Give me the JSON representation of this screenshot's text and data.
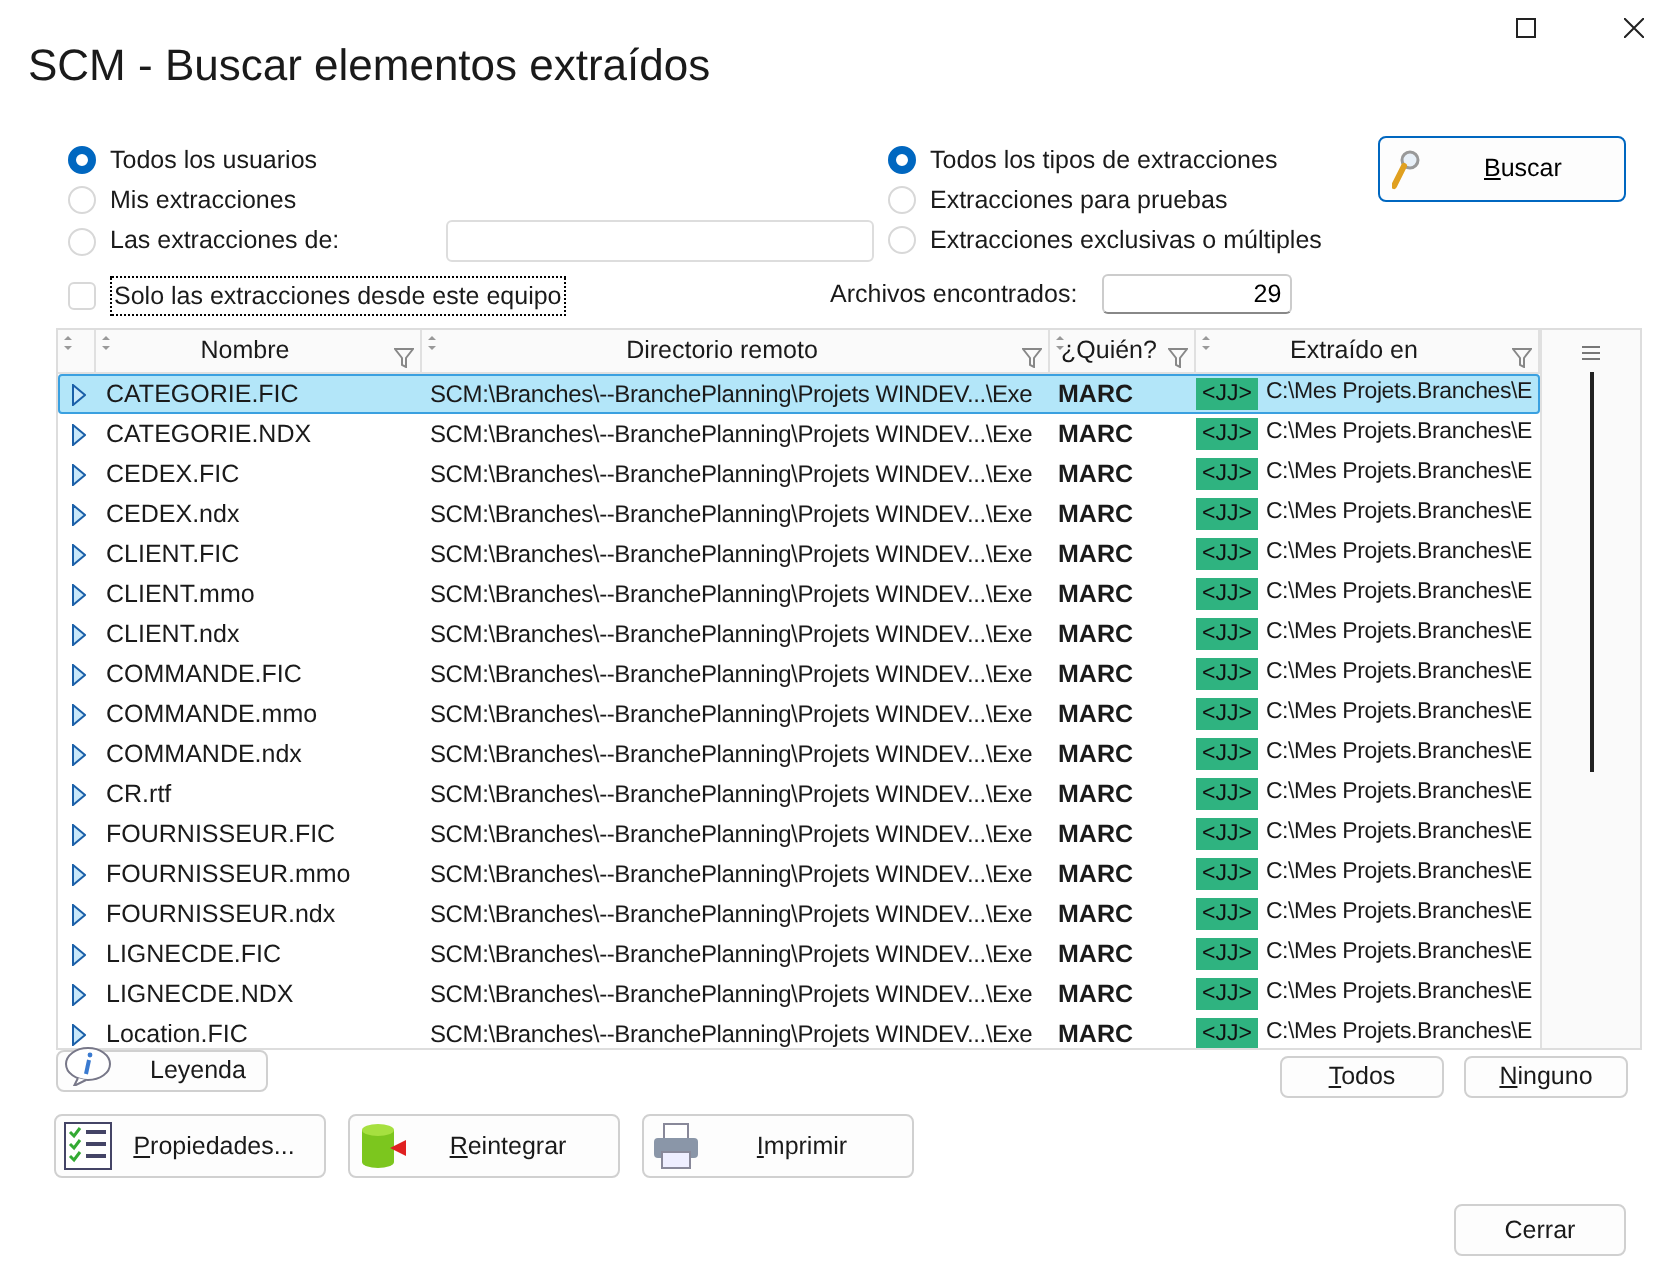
{
  "window": {
    "title": "SCM - Buscar elementos extraídos"
  },
  "user_filter": [
    {
      "label": "Todos los usuarios",
      "selected": true
    },
    {
      "label": "Mis extracciones",
      "selected": false
    },
    {
      "label": "Las extracciones de:",
      "selected": false
    }
  ],
  "local_only": {
    "label": "Solo las extracciones desde este equipo",
    "checked": false
  },
  "type_filter": [
    {
      "label": "Todos los tipos de extracciones",
      "selected": true
    },
    {
      "label": "Extracciones para pruebas",
      "selected": false
    },
    {
      "label": "Extracciones exclusivas o múltiples",
      "selected": false
    }
  ],
  "search_button": "Buscar",
  "found": {
    "label": "Archivos encontrados:",
    "value": "29"
  },
  "table": {
    "columns": [
      "Nombre",
      "Directorio remoto",
      "¿Quién?",
      "Extraído en"
    ],
    "rows": [
      {
        "name": "CATEGORIE.FIC",
        "remote": "SCM:\\Branches\\--BranchePlanning\\Projets WINDEV...\\Exe",
        "who": "MARC",
        "tag": "<JJ>",
        "local": "C:\\Mes Projets.Branches\\E",
        "selected": true
      },
      {
        "name": "CATEGORIE.NDX",
        "remote": "SCM:\\Branches\\--BranchePlanning\\Projets WINDEV...\\Exe",
        "who": "MARC",
        "tag": "<JJ>",
        "local": "C:\\Mes Projets.Branches\\E",
        "selected": false
      },
      {
        "name": "CEDEX.FIC",
        "remote": "SCM:\\Branches\\--BranchePlanning\\Projets WINDEV...\\Exe",
        "who": "MARC",
        "tag": "<JJ>",
        "local": "C:\\Mes Projets.Branches\\E",
        "selected": false
      },
      {
        "name": "CEDEX.ndx",
        "remote": "SCM:\\Branches\\--BranchePlanning\\Projets WINDEV...\\Exe",
        "who": "MARC",
        "tag": "<JJ>",
        "local": "C:\\Mes Projets.Branches\\E",
        "selected": false
      },
      {
        "name": "CLIENT.FIC",
        "remote": "SCM:\\Branches\\--BranchePlanning\\Projets WINDEV...\\Exe",
        "who": "MARC",
        "tag": "<JJ>",
        "local": "C:\\Mes Projets.Branches\\E",
        "selected": false
      },
      {
        "name": "CLIENT.mmo",
        "remote": "SCM:\\Branches\\--BranchePlanning\\Projets WINDEV...\\Exe",
        "who": "MARC",
        "tag": "<JJ>",
        "local": "C:\\Mes Projets.Branches\\E",
        "selected": false
      },
      {
        "name": "CLIENT.ndx",
        "remote": "SCM:\\Branches\\--BranchePlanning\\Projets WINDEV...\\Exe",
        "who": "MARC",
        "tag": "<JJ>",
        "local": "C:\\Mes Projets.Branches\\E",
        "selected": false
      },
      {
        "name": "COMMANDE.FIC",
        "remote": "SCM:\\Branches\\--BranchePlanning\\Projets WINDEV...\\Exe",
        "who": "MARC",
        "tag": "<JJ>",
        "local": "C:\\Mes Projets.Branches\\E",
        "selected": false
      },
      {
        "name": "COMMANDE.mmo",
        "remote": "SCM:\\Branches\\--BranchePlanning\\Projets WINDEV...\\Exe",
        "who": "MARC",
        "tag": "<JJ>",
        "local": "C:\\Mes Projets.Branches\\E",
        "selected": false
      },
      {
        "name": "COMMANDE.ndx",
        "remote": "SCM:\\Branches\\--BranchePlanning\\Projets WINDEV...\\Exe",
        "who": "MARC",
        "tag": "<JJ>",
        "local": "C:\\Mes Projets.Branches\\E",
        "selected": false
      },
      {
        "name": "CR.rtf",
        "remote": "SCM:\\Branches\\--BranchePlanning\\Projets WINDEV...\\Exe",
        "who": "MARC",
        "tag": "<JJ>",
        "local": "C:\\Mes Projets.Branches\\E",
        "selected": false
      },
      {
        "name": "FOURNISSEUR.FIC",
        "remote": "SCM:\\Branches\\--BranchePlanning\\Projets WINDEV...\\Exe",
        "who": "MARC",
        "tag": "<JJ>",
        "local": "C:\\Mes Projets.Branches\\E",
        "selected": false
      },
      {
        "name": "FOURNISSEUR.mmo",
        "remote": "SCM:\\Branches\\--BranchePlanning\\Projets WINDEV...\\Exe",
        "who": "MARC",
        "tag": "<JJ>",
        "local": "C:\\Mes Projets.Branches\\E",
        "selected": false
      },
      {
        "name": "FOURNISSEUR.ndx",
        "remote": "SCM:\\Branches\\--BranchePlanning\\Projets WINDEV...\\Exe",
        "who": "MARC",
        "tag": "<JJ>",
        "local": "C:\\Mes Projets.Branches\\E",
        "selected": false
      },
      {
        "name": "LIGNECDE.FIC",
        "remote": "SCM:\\Branches\\--BranchePlanning\\Projets WINDEV...\\Exe",
        "who": "MARC",
        "tag": "<JJ>",
        "local": "C:\\Mes Projets.Branches\\E",
        "selected": false
      },
      {
        "name": "LIGNECDE.NDX",
        "remote": "SCM:\\Branches\\--BranchePlanning\\Projets WINDEV...\\Exe",
        "who": "MARC",
        "tag": "<JJ>",
        "local": "C:\\Mes Projets.Branches\\E",
        "selected": false
      },
      {
        "name": "Location.FIC",
        "remote": "SCM:\\Branches\\--BranchePlanning\\Projets WINDEV...\\Exe",
        "who": "MARC",
        "tag": "<JJ>",
        "local": "C:\\Mes Projets.Branches\\E",
        "selected": false
      }
    ]
  },
  "legend_button": "Leyenda",
  "select_buttons": [
    "Todos",
    "Ninguno"
  ],
  "action_buttons": [
    {
      "kind": "properties",
      "label": "Propiedades..."
    },
    {
      "kind": "reintegrate",
      "label": "Reintegrar"
    },
    {
      "kind": "print",
      "label": "Imprimir"
    }
  ],
  "close_button": "Cerrar"
}
